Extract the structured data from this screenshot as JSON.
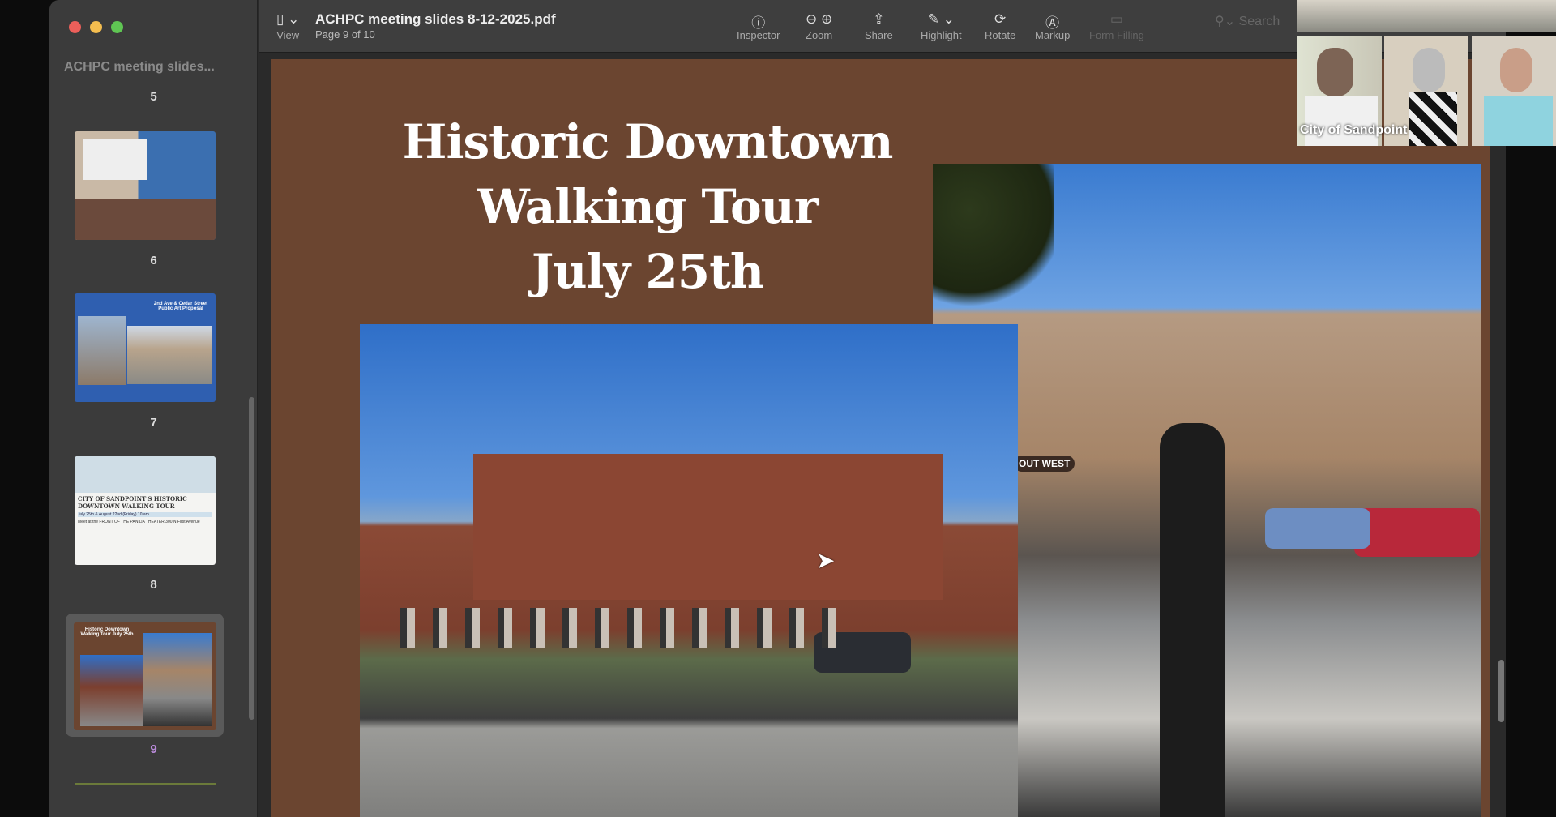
{
  "window": {
    "colors": {
      "close": "#ec5f5a",
      "minimize": "#f4bd4f",
      "maximize": "#5fc553"
    }
  },
  "sidebar": {
    "title": "ACHPC meeting slides...",
    "pages": [
      {
        "label": "5"
      },
      {
        "label": "6"
      },
      {
        "label": "7",
        "thumb_text": "2nd Ave & Cedar Street Public Art Proposal"
      },
      {
        "label": "8",
        "thumb_text": "CITY OF SANDPOINT'S HISTORIC DOWNTOWN WALKING TOUR",
        "thumb_date": "July 25th & August 22nd (Friday) 10 am",
        "thumb_note": "Meet at the FRONT OF THE PANIDA THEATER 300 N First Avenue"
      },
      {
        "label": "9",
        "thumb_text": "Historic Downtown Walking Tour July 25th"
      }
    ],
    "selected_page": 9
  },
  "toolbar": {
    "view": "View",
    "filename": "ACHPC meeting slides 8-12-2025.pdf",
    "page_info": "Page 9 of 10",
    "inspector": "Inspector",
    "zoom": "Zoom",
    "share": "Share",
    "highlight": "Highlight",
    "rotate": "Rotate",
    "markup": "Markup",
    "form_filling": "Form Filling",
    "search_placeholder": "Search"
  },
  "slide": {
    "title_lines": [
      "Historic Downtown",
      "Walking Tour",
      "July 25th"
    ],
    "storefront_sign": "OUT WEST",
    "bg_color": "#6b4530"
  },
  "video": {
    "participant_label": "City of Sandpoint"
  }
}
